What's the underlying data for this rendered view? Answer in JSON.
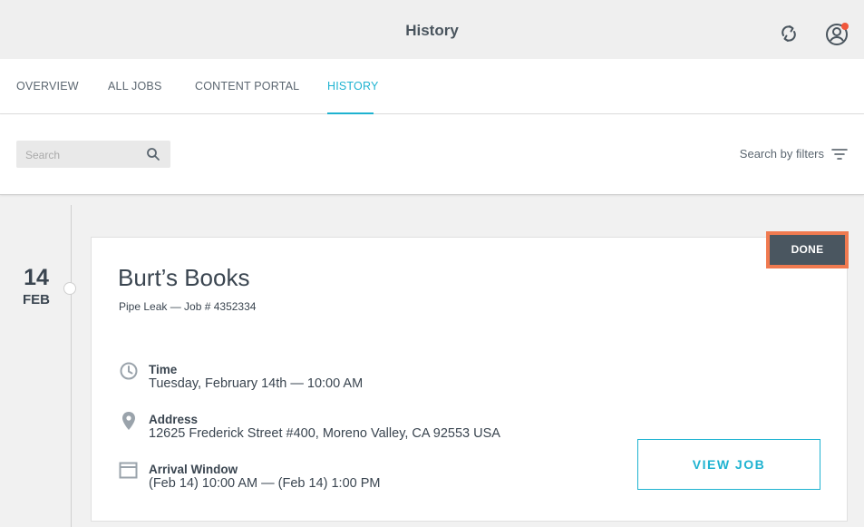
{
  "header": {
    "title": "History"
  },
  "tabs": [
    {
      "label": "OVERVIEW"
    },
    {
      "label": "ALL JOBS"
    },
    {
      "label": "CONTENT PORTAL"
    },
    {
      "label": "HISTORY",
      "active": true
    }
  ],
  "search": {
    "placeholder": "Search"
  },
  "filters": {
    "label": "Search by filters"
  },
  "timeline": {
    "day": "14",
    "month": "FEB"
  },
  "job": {
    "status": "DONE",
    "title": "Burt’s Books",
    "subtitle": "Pipe Leak — Job # 4352334",
    "time_label": "Time",
    "time_value": "Tuesday, February 14th — 10:00 AM",
    "address_label": "Address",
    "address_value": "12625 Frederick Street #400, Moreno Valley, CA 92553 USA",
    "arrival_label": "Arrival Window",
    "arrival_value": "(Feb 14) 10:00 AM — (Feb 14) 1:00 PM",
    "view_button": "VIEW JOB"
  },
  "colors": {
    "accent": "#1fb3d1",
    "highlight": "#f07a50",
    "done_bg": "#4a5660",
    "notification": "#f0573c"
  },
  "icons": [
    "sync-icon",
    "profile-icon",
    "search-icon",
    "filter-icon",
    "clock-icon",
    "location-pin-icon",
    "calendar-icon"
  ]
}
